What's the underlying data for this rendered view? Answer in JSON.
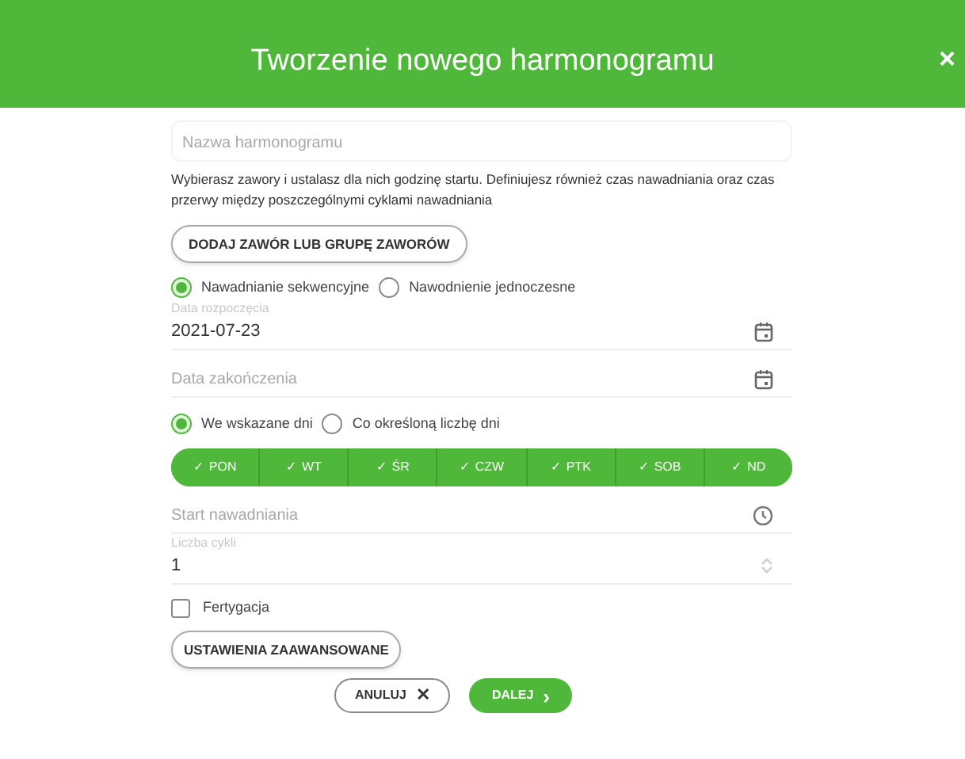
{
  "dialog": {
    "title": "Tworzenie nowego harmonogramu",
    "close": "×"
  },
  "name_field": {
    "placeholder": "Nazwa harmonogramu"
  },
  "description": "Wybierasz zawory i ustalasz dla nich godzinę startu. Definiujesz również czas nawadniania oraz czas przerwy między poszczególnymi cyklami nawadniania",
  "add_valve_button": "DODAJ ZAWÓR LUB GRUPĘ ZAWORÓW",
  "irrigation_mode": [
    {
      "label": "Nawadnianie sekwencyjne",
      "selected": true
    },
    {
      "label": "Nawodnienie jednoczesne",
      "selected": false
    }
  ],
  "date_fields": [
    {
      "label": "Data rozpoczęcia",
      "value": "2021-07-23"
    },
    {
      "placeholder": "Data zakończenia"
    }
  ],
  "schedule_mode": [
    {
      "label": "We wskazane dni",
      "selected": true
    },
    {
      "label": "Co określoną liczbę dni",
      "selected": false
    }
  ],
  "days": [
    {
      "check": "✓",
      "label": "PON",
      "selected": true
    },
    {
      "check": "✓",
      "label": "WT",
      "selected": true
    },
    {
      "check": "✓",
      "label": "ŚR",
      "selected": true
    },
    {
      "check": "✓",
      "label": "CZW",
      "selected": true
    },
    {
      "check": "✓",
      "label": "PTK",
      "selected": true
    },
    {
      "check": "✓",
      "label": "SOB",
      "selected": true
    },
    {
      "check": "✓",
      "label": "ND",
      "selected": true
    }
  ],
  "start_field": {
    "placeholder": "Start nawadniania"
  },
  "cycles_field": {
    "label": "Liczba cykli",
    "value": "1"
  },
  "fertigation": {
    "label": "Fertygacja",
    "checked": false
  },
  "advanced_button": "USTAWIENIA ZAAWANSOWANE",
  "footer": {
    "cancel": {
      "label": "ANULUJ",
      "icon": "✕"
    },
    "next": {
      "label": "DALEJ",
      "icon": "›"
    }
  }
}
